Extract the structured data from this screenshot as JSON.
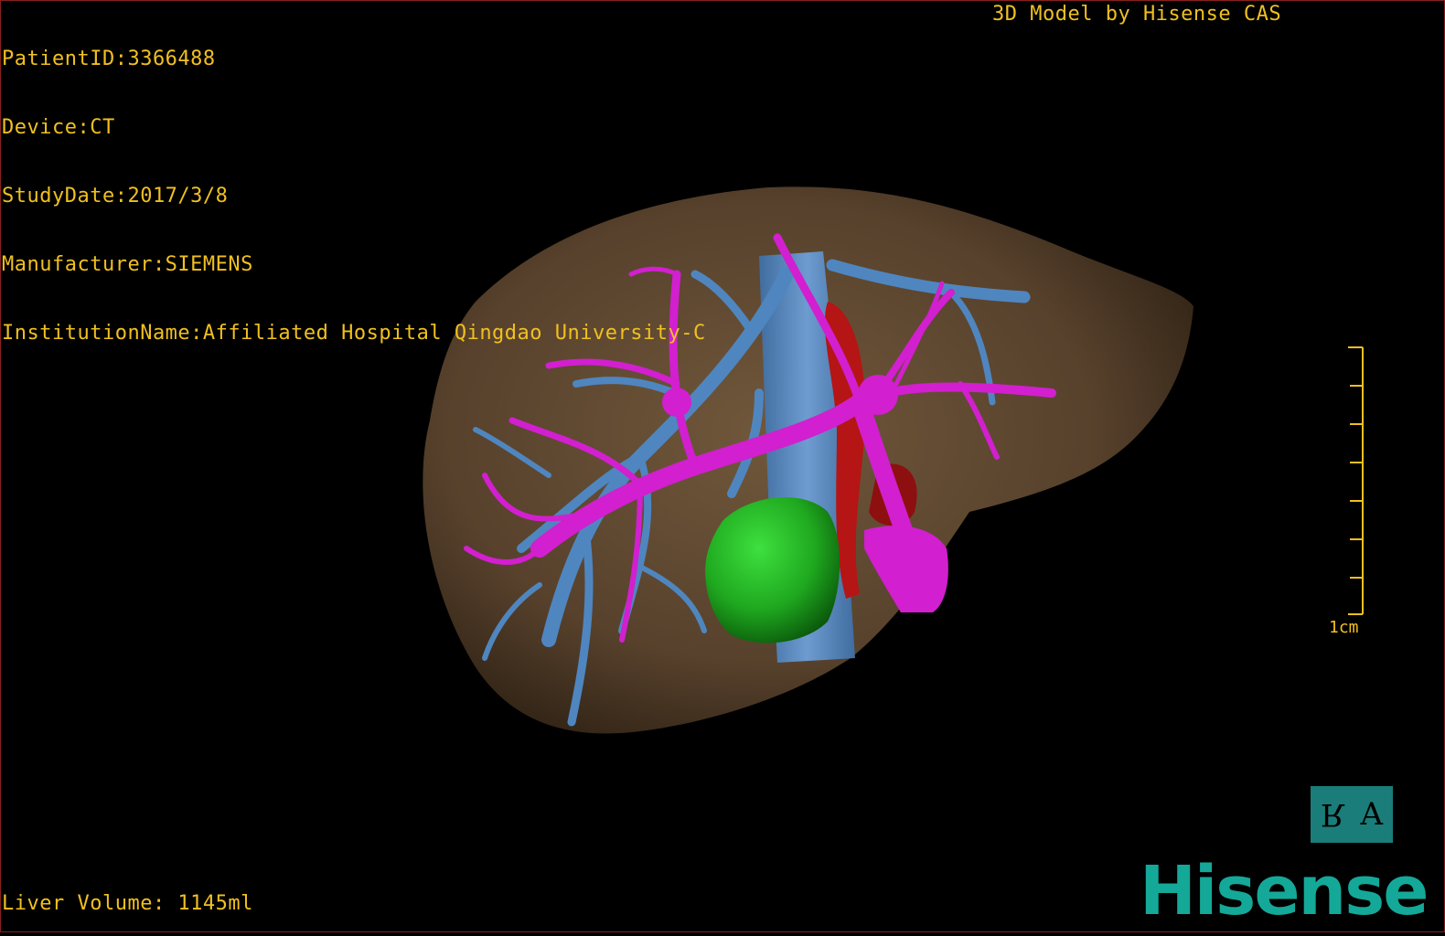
{
  "info": {
    "patient_id": "PatientID:3366488",
    "device": "Device:CT",
    "study_date": "StudyDate:2017/3/8",
    "manufacturer": "Manufacturer:SIEMENS",
    "institution": "InstitutionName:Affiliated Hospital Qingdao University-C"
  },
  "credit": "3D Model by Hisense CAS",
  "volume": "Liver Volume: 1145ml",
  "scale": {
    "label": "1cm"
  },
  "orientation": {
    "left": "R",
    "right": "A"
  },
  "brand": "Hisense",
  "colors": {
    "overlay_text": "#f0c020",
    "liver": "#6b5236",
    "portal_vein": "#d21fcf",
    "hepatic_vein": "#4f86c0",
    "artery": "#b51515",
    "tumor": "#1fa81f",
    "brand": "#14a898",
    "orientation_box": "#1a7d7a"
  }
}
